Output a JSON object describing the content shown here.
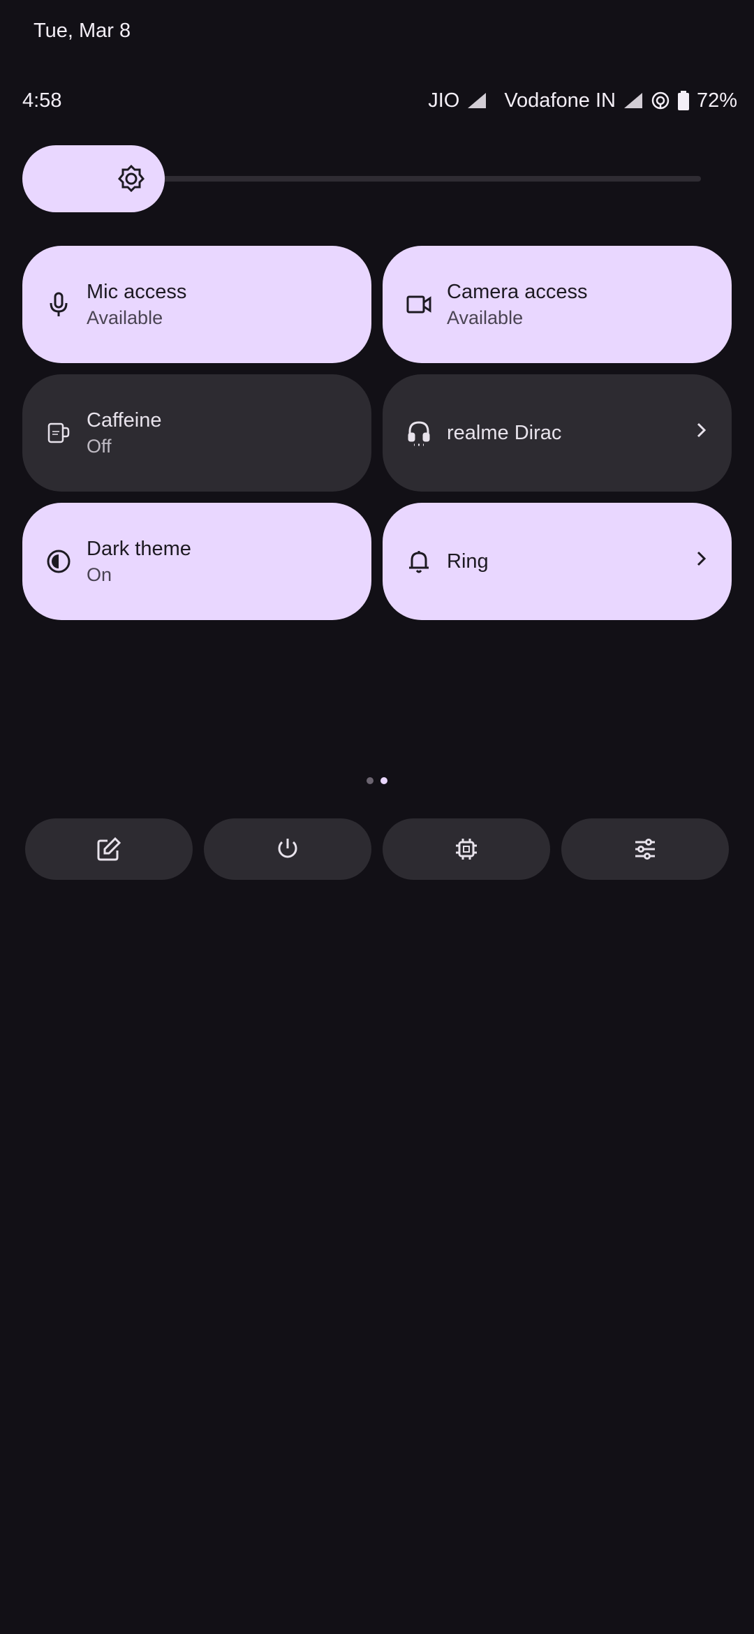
{
  "header": {
    "date": "Tue, Mar 8"
  },
  "status_bar": {
    "time": "4:58",
    "carrier1": "JIO",
    "carrier2": "Vodafone IN",
    "battery": "72%",
    "icons": [
      "signal-icon",
      "signal-icon",
      "hotspot-icon",
      "battery-icon"
    ]
  },
  "brightness": {
    "icon": "brightness-icon",
    "level_fraction": 0.1
  },
  "tiles": [
    {
      "label": "Mic access",
      "sub": "Available",
      "state": "on",
      "icon": "mic-icon"
    },
    {
      "label": "Camera access",
      "sub": "Available",
      "state": "on",
      "icon": "camera-icon"
    },
    {
      "label": "Caffeine",
      "sub": "Off",
      "state": "off",
      "icon": "coffee-cup-icon"
    },
    {
      "label": "realme Dirac",
      "sub": "",
      "state": "off",
      "icon": "headphones-icon"
    },
    {
      "label": "Dark theme",
      "sub": "On",
      "state": "on",
      "icon": "dark-theme-icon"
    },
    {
      "label": "Ring",
      "sub": "",
      "state": "on",
      "icon": "bell-icon"
    }
  ],
  "pager": {
    "pages": 2,
    "current": 2
  },
  "footer_buttons": [
    {
      "icon": "edit-icon"
    },
    {
      "icon": "power-icon"
    },
    {
      "icon": "chip-icon"
    },
    {
      "icon": "settings-sliders-icon"
    }
  ],
  "colors": {
    "background": "#121016",
    "tile_on": "#e9d7ff",
    "tile_off": "#2d2b31"
  }
}
